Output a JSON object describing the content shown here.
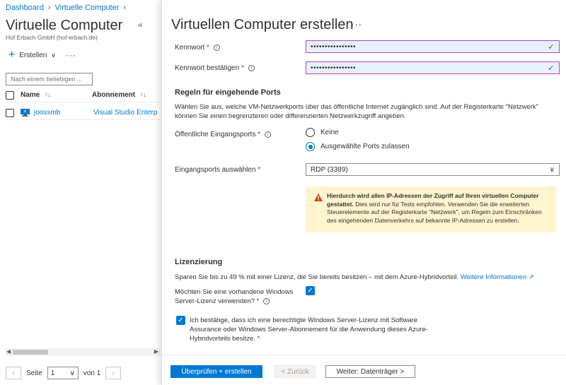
{
  "breadcrumb": {
    "item1": "Dashboard",
    "item2": "Virtuelle Computer"
  },
  "left_blade": {
    "title": "Virtuelle Computer",
    "subtitle": "Hof Erbach GmbH (hof-erbach.de)",
    "create_label": "Erstellen",
    "filter_placeholder": "Nach einem beliebigen ...",
    "columns": {
      "name": "Name",
      "subscription": "Abonnement"
    },
    "rows": [
      {
        "name": "joossmb",
        "subscription": "Visual Studio Enterprise"
      }
    ],
    "pager": {
      "page_label": "Seite",
      "page_value": "1",
      "of_label": "von 1"
    }
  },
  "right_blade": {
    "title": "Virtuellen Computer erstellen",
    "password_label": "Kennwort",
    "password_value": "••••••••••••••••",
    "confirm_label": "Kennwort bestätigen",
    "confirm_value": "••••••••••••••••",
    "inbound_heading": "Regeln für eingehende Ports",
    "inbound_desc": "Wählen Sie aus, welche VM-Netzwerkports über das öffentliche Internet zugänglich sind. Auf der Registerkarte \"Netzwerk\" können Sie einen begrenzteren oder differenzierten Netzwerkzugriff angeben.",
    "public_ports_label": "Öffentliche Eingangsports",
    "radio_none": "Keine",
    "radio_selected": "Ausgewählte Ports zulassen",
    "select_ports_label": "Eingangsports auswählen",
    "select_ports_value": "RDP (3389)",
    "warning_bold": "Hierdurch wird allen IP-Adressen der Zugriff auf Ihren virtuellen Computer gestattet.",
    "warning_text": "Dies wird nur für Tests empfohlen. Verwenden Sie die erweiterten Steuerelemente auf der Registerkarte \"Netzwerk\", um Regeln zum Einschränken des eingehenden Datenverkehrs auf bekannte IP-Adressen zu erstellen.",
    "license_heading": "Lizenzierung",
    "license_desc": "Sparen Sie bis zu 49 % mit einer Lizenz, die Sie bereits besitzen – mit dem Azure-Hybridvorteil.",
    "license_link": "Weitere Informationen",
    "existing_license_label_1": "Möchten Sie eine vorhandene Windows",
    "existing_license_label_2": "Server-Lizenz verwenden?",
    "confirm_license_text": "Ich bestätige, dass ich eine berechtigte Windows Server-Lizenz mit Software Assurance oder Windows Server-Abonnement für die Anwendung dieses Azure-Hybridvorteils besitze."
  },
  "footer": {
    "review_create": "Überprüfen + erstellen",
    "back": "< Zurück",
    "next": "Weiter: Datenträger >"
  },
  "colors": {
    "accent": "#0078d4",
    "warning_bg": "#fff4ce",
    "autofill_border": "#b146c2"
  }
}
